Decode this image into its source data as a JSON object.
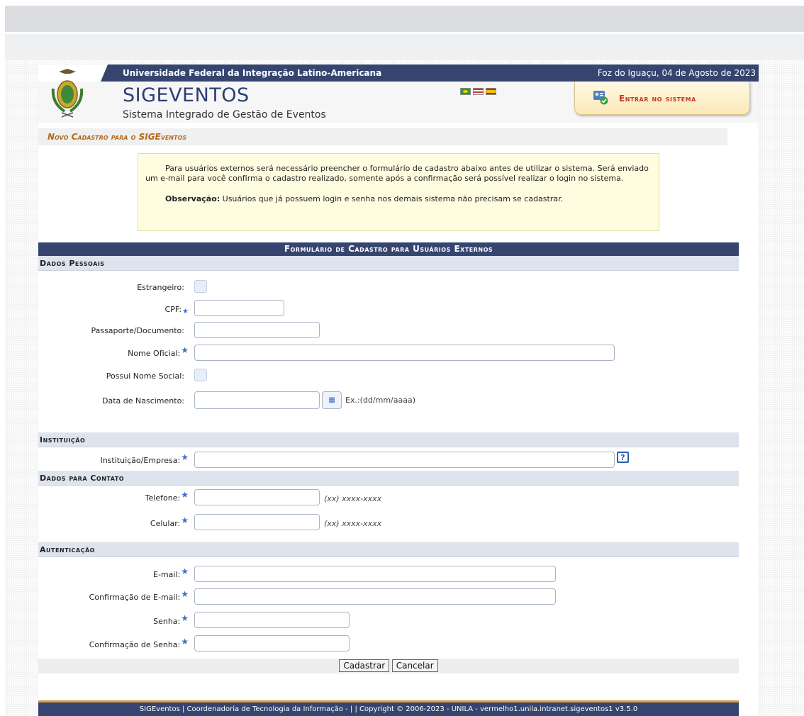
{
  "header": {
    "university": "Universidade Federal da Integração Latino-Americana",
    "date": "Foz do Iguaçu, 04 de Agosto de 2023",
    "brand": "SIGEVENTOS",
    "subtitle": "Sistema Integrado de Gestão de Eventos",
    "login_label": "Entrar no sistema"
  },
  "page_title": "Novo Cadastro para o SIGEventos",
  "notice": {
    "line1": "Para usuários externos será necessário preencher o formulário de cadastro abaixo antes de utilizar o sistema. Será enviado um e-mail para você confirma o cadastro realizado, somente após a confirmação será possível realizar o login no sistema.",
    "obs_label": "Observação:",
    "obs_text": " Usuários que já possuem login e senha nos demais sistema não precisam se cadastrar."
  },
  "form": {
    "title": "Formulário de Cadastro para Usuários Externos",
    "sections": {
      "pessoais": "Dados Pessoais",
      "instituicao": "Instituição",
      "contato": "Dados para Contato",
      "autenticacao": "Autenticação"
    },
    "fields": {
      "estrangeiro": "Estrangeiro:",
      "cpf": "CPF:",
      "passaporte": "Passaporte/Documento:",
      "nome": "Nome Oficial:",
      "nome_social": "Possui Nome Social:",
      "nascimento": "Data de Nascimento:",
      "nascimento_hint": "Ex.:(dd/mm/aaaa)",
      "instituicao": "Instituição/Empresa:",
      "telefone": "Telefone:",
      "telefone_hint": "(xx) xxxx-xxxx",
      "celular": "Celular:",
      "celular_hint": "(xx) xxxx-xxxx",
      "email": "E-mail:",
      "email_conf": "Confirmação de E-mail:",
      "senha": "Senha:",
      "senha_conf": "Confirmação de Senha:"
    },
    "buttons": {
      "submit": "Cadastrar",
      "cancel": "Cancelar"
    }
  },
  "footer": "SIGEventos | Coordenadoria de Tecnologia da Informação - | | Copyright © 2006-2023 - UNILA - vermelho1.unila.intranet.sigeventos1 v3.5.0",
  "colors": {
    "navy": "#35456f",
    "accent": "#d39a3f",
    "title_orange": "#b56b1c",
    "login_red": "#c4361d"
  }
}
